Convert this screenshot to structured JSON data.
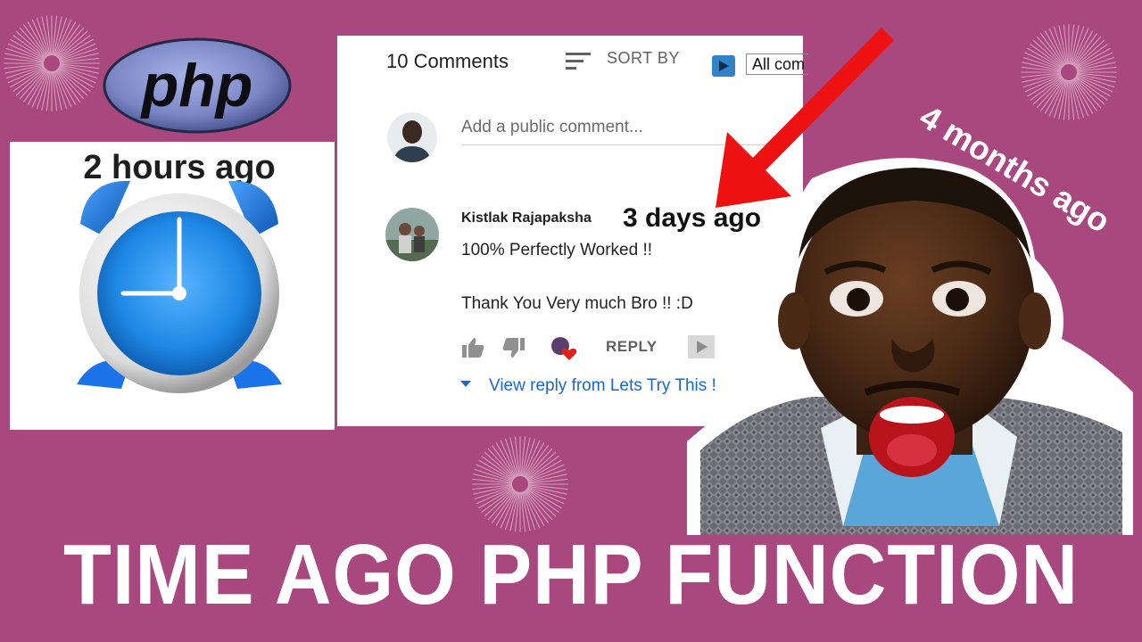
{
  "thumbnail": {
    "logo_text": "php",
    "clock_caption": "2 hours ago",
    "months_caption": "4 months ago",
    "title": "TIME AGO PHP FUNCTION"
  },
  "comments_panel": {
    "count_label": "10 Comments",
    "sort_label": "SORT BY",
    "filter_value": "All com",
    "add_placeholder": "Add a public comment...",
    "comment": {
      "author": "Kistlak Rajapaksha",
      "time": "3 days ago",
      "line1": "100% Perfectly Worked !!",
      "line2": "Thank You Very much Bro !! :D",
      "reply_label": "REPLY",
      "view_reply": "View reply from Lets Try This !"
    }
  },
  "colors": {
    "background": "#a9477f",
    "arrow": "#ee1111",
    "link": "#1968d0",
    "clock_blue": "#1e88e5"
  },
  "icons": [
    "sort-icon",
    "extension-icon",
    "thumbs-up-icon",
    "thumbs-down-icon",
    "heart-icon",
    "extension-icon",
    "caret-down-icon",
    "clock-icon",
    "arrow-icon"
  ]
}
